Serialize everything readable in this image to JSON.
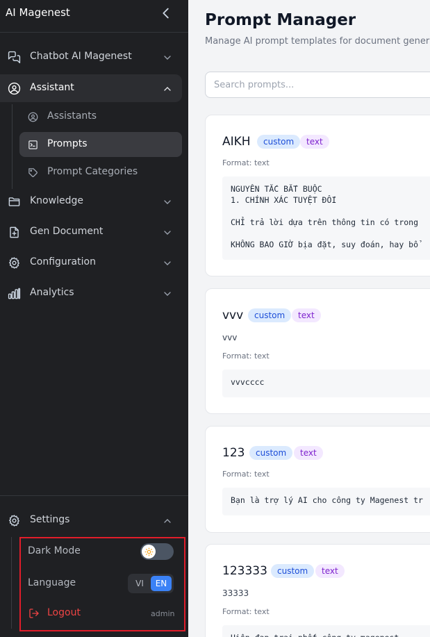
{
  "sidebar": {
    "brand": "AI Magenest",
    "nav": [
      {
        "label": "Chatbot AI Magenest",
        "icon": "chat-bubbles-icon"
      },
      {
        "label": "Assistant",
        "icon": "user-circle-icon"
      },
      {
        "label": "Knowledge",
        "icon": "folder-icon"
      },
      {
        "label": "Gen Document",
        "icon": "file-plus-icon"
      },
      {
        "label": "Configuration",
        "icon": "gear-icon"
      },
      {
        "label": "Analytics",
        "icon": "bar-chart-icon"
      }
    ],
    "assistant_sub": [
      {
        "label": "Assistants",
        "icon": "user-circle-icon"
      },
      {
        "label": "Prompts",
        "icon": "terminal-icon"
      },
      {
        "label": "Prompt Categories",
        "icon": "tag-icon"
      }
    ],
    "settings": {
      "label": "Settings",
      "dark_mode_label": "Dark Mode",
      "language_label": "Language",
      "lang_vi": "VI",
      "lang_en": "EN",
      "selected_language": "EN",
      "logout_label": "Logout",
      "username": "admin",
      "dark_mode_on": false
    }
  },
  "main": {
    "title": "Prompt Manager",
    "subtitle": "Manage AI prompt templates for document generation",
    "search_placeholder": "Search prompts...",
    "cards": [
      {
        "name": "AIKH",
        "badges": [
          "custom",
          "text"
        ],
        "description": "",
        "format": "Format: text",
        "content": "NGUYÊN TẮC BẮT BUỘC\n1. CHÍNH XÁC TUYỆT ĐỐI\n\nCHỈ trả lời dựa trên thông tin có trong\n\nKHÔNG BAO GIỜ bịa đặt, suy đoán, hay bổ"
      },
      {
        "name": "vvv",
        "badges": [
          "custom",
          "text"
        ],
        "description": "vvv",
        "format": "Format: text",
        "content": "vvvcccc"
      },
      {
        "name": "123",
        "badges": [
          "custom",
          "text"
        ],
        "description": "",
        "format": "Format: text",
        "content": "Bạn là trợ lý AI cho công ty Magenest tr"
      },
      {
        "name": "123333",
        "badges": [
          "custom",
          "text"
        ],
        "description": "33333",
        "format": "Format: text",
        "content": "Hiện đạp trai nhất công ty magenest"
      }
    ]
  },
  "colors": {
    "sidebar_bg": "#1f2023",
    "accent_blue": "#3b82f6",
    "logout_red": "#ef4444",
    "highlight_red": "#e11d2a",
    "badge_custom": "#dbeafe",
    "badge_text": "#f3e8ff"
  }
}
